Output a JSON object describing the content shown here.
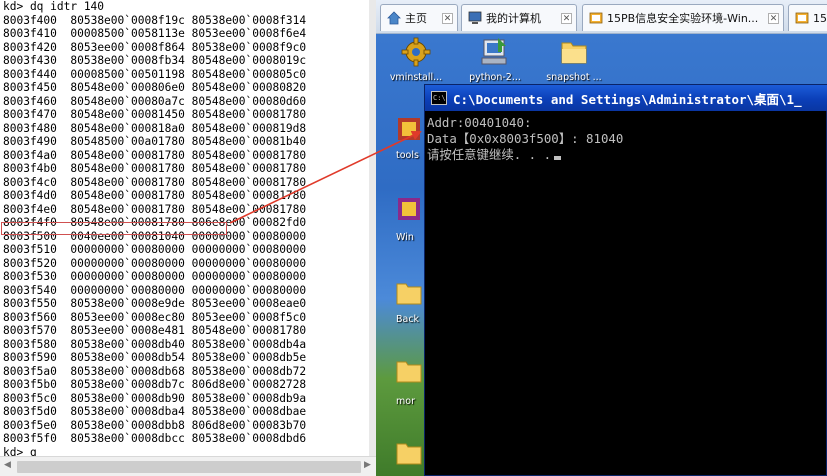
{
  "debugger": {
    "command": "kd> dq idtr 140",
    "rows": [
      {
        "addr": "8003f400",
        "q1": "80538e00`0008f19c",
        "q2": "80538e00`0008f314"
      },
      {
        "addr": "8003f410",
        "q1": "00008500`0058113e",
        "q2": "8053ee00`0008f6e4"
      },
      {
        "addr": "8003f420",
        "q1": "8053ee00`0008f864",
        "q2": "80538e00`0008f9c0"
      },
      {
        "addr": "8003f430",
        "q1": "80538e00`0008fb34",
        "q2": "80548e00`0008019c"
      },
      {
        "addr": "8003f440",
        "q1": "00008500`00501198",
        "q2": "80548e00`000805c0"
      },
      {
        "addr": "8003f450",
        "q1": "80548e00`000806e0",
        "q2": "80548e00`00080820"
      },
      {
        "addr": "8003f460",
        "q1": "80548e00`00080a7c",
        "q2": "80548e00`00080d60"
      },
      {
        "addr": "8003f470",
        "q1": "80548e00`00081450",
        "q2": "80548e00`00081780"
      },
      {
        "addr": "8003f480",
        "q1": "80548e00`000818a0",
        "q2": "80548e00`000819d8"
      },
      {
        "addr": "8003f490",
        "q1": "80548500`00a01780",
        "q2": "80548e00`00081b40"
      },
      {
        "addr": "8003f4a0",
        "q1": "80548e00`00081780",
        "q2": "80548e00`00081780"
      },
      {
        "addr": "8003f4b0",
        "q1": "80548e00`00081780",
        "q2": "80548e00`00081780"
      },
      {
        "addr": "8003f4c0",
        "q1": "80548e00`00081780",
        "q2": "80548e00`00081780"
      },
      {
        "addr": "8003f4d0",
        "q1": "80548e00`00081780",
        "q2": "80548e00`00081780"
      },
      {
        "addr": "8003f4e0",
        "q1": "80548e00`00081780",
        "q2": "80548e00`00081780"
      },
      {
        "addr": "8003f4f0",
        "q1": "80548e00`00081780",
        "q2": "806e8e00`00082fd0"
      },
      {
        "addr": "8003f500",
        "q1": "0040ee00`00081040",
        "q2": "00000000`00080000"
      },
      {
        "addr": "8003f510",
        "q1": "00000000`00080000",
        "q2": "00000000`00080000"
      },
      {
        "addr": "8003f520",
        "q1": "00000000`00080000",
        "q2": "00000000`00080000"
      },
      {
        "addr": "8003f530",
        "q1": "00000000`00080000",
        "q2": "00000000`00080000"
      },
      {
        "addr": "8003f540",
        "q1": "00000000`00080000",
        "q2": "00000000`00080000"
      },
      {
        "addr": "8003f550",
        "q1": "80538e00`0008e9de",
        "q2": "8053ee00`0008eae0"
      },
      {
        "addr": "8003f560",
        "q1": "8053ee00`0008ec80",
        "q2": "8053ee00`0008f5c0"
      },
      {
        "addr": "8003f570",
        "q1": "8053ee00`0008e481",
        "q2": "80548e00`00081780"
      },
      {
        "addr": "8003f580",
        "q1": "80538e00`0008db40",
        "q2": "80538e00`0008db4a"
      },
      {
        "addr": "8003f590",
        "q1": "80538e00`0008db54",
        "q2": "80538e00`0008db5e"
      },
      {
        "addr": "8003f5a0",
        "q1": "80538e00`0008db68",
        "q2": "80538e00`0008db72"
      },
      {
        "addr": "8003f5b0",
        "q1": "80538e00`0008db7c",
        "q2": "806d8e00`00082728"
      },
      {
        "addr": "8003f5c0",
        "q1": "80538e00`0008db90",
        "q2": "80538e00`0008db9a"
      },
      {
        "addr": "8003f5d0",
        "q1": "80538e00`0008dba4",
        "q2": "80538e00`0008dbae"
      },
      {
        "addr": "8003f5e0",
        "q1": "80538e00`0008dbb8",
        "q2": "806d8e00`00083b70"
      },
      {
        "addr": "8003f5f0",
        "q1": "80538e00`0008dbcc",
        "q2": "80538e00`0008dbd6"
      }
    ],
    "last_command": "kd> g"
  },
  "vm_tabs": [
    {
      "label": "主页",
      "icon": "home-icon"
    },
    {
      "label": "我的计算机",
      "icon": "computer-icon"
    },
    {
      "label": "15PB信息安全实验环境-Win...",
      "icon": "vm-icon"
    },
    {
      "label": "15",
      "icon": "vm-icon"
    }
  ],
  "desktop_icons": [
    {
      "label": "vminstall...",
      "icon": "gear-icon"
    },
    {
      "label": "python-2...",
      "icon": "installer-icon"
    },
    {
      "label": "snapshot ...",
      "icon": "folder-icon"
    }
  ],
  "side_labels": [
    "tools",
    "Win",
    "Back",
    "mor"
  ],
  "console": {
    "title": "C:\\Documents and Settings\\Administrator\\桌面\\1_",
    "icon_text": "C:\\",
    "lines": [
      "Addr:00401040:",
      "Data【0x0x8003f500】: 81040",
      "请按任意键继续. . ."
    ]
  },
  "colors": {
    "console_title": "#0b3fb8",
    "highlight": "#d05050",
    "desktop": "#2f6cc4"
  }
}
